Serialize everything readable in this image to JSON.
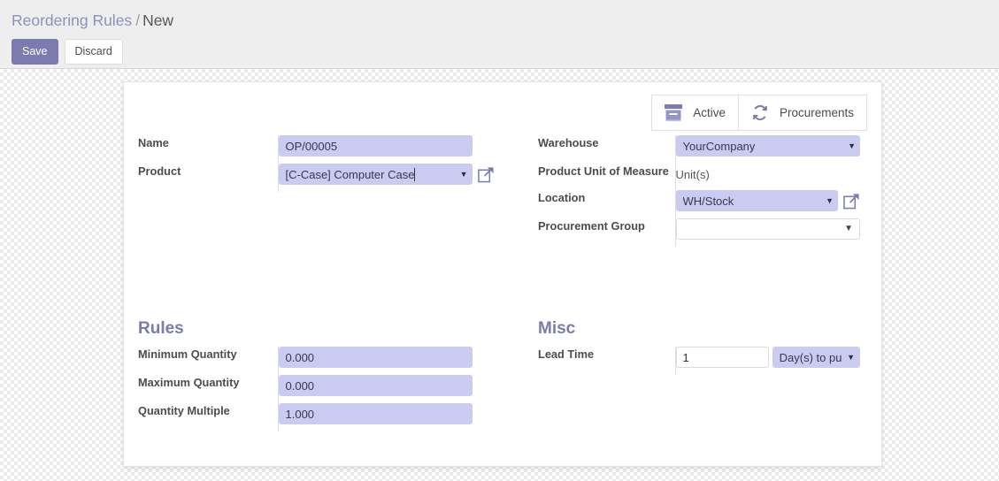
{
  "breadcrumb": {
    "root": "Reordering Rules",
    "separator": "/",
    "current": "New"
  },
  "toolbar": {
    "save_label": "Save",
    "discard_label": "Discard"
  },
  "stat_buttons": [
    {
      "label": "Active",
      "icon": "archive-box-icon"
    },
    {
      "label": "Procurements",
      "icon": "refresh-sync-icon"
    }
  ],
  "form": {
    "left": [
      {
        "label": "Name",
        "value": "OP/00005",
        "type": "text"
      },
      {
        "label": "Product",
        "value": "[C-Case] Computer Case",
        "type": "many2one"
      }
    ],
    "right": [
      {
        "label": "Warehouse",
        "value": "YourCompany",
        "type": "select"
      },
      {
        "label": "Product Unit of Measure",
        "value": "Unit(s)",
        "type": "readonly"
      },
      {
        "label": "Location",
        "value": "WH/Stock",
        "type": "select"
      },
      {
        "label": "Procurement Group",
        "value": "",
        "type": "select-empty"
      }
    ]
  },
  "rules_group": {
    "title": "Rules",
    "fields": [
      {
        "label": "Minimum Quantity",
        "value": "0.000"
      },
      {
        "label": "Maximum Quantity",
        "value": "0.000"
      },
      {
        "label": "Quantity Multiple",
        "value": "1.000"
      }
    ]
  },
  "misc_group": {
    "title": "Misc",
    "lead_time_label": "Lead Time",
    "lead_time_value": "1",
    "lead_time_unit": "Day(s) to purchase"
  },
  "colors": {
    "accent": "#7c7bad",
    "input_bg": "#cbcbf2",
    "header_bg": "#eeeeee",
    "label_text": "#4c4c4c"
  }
}
